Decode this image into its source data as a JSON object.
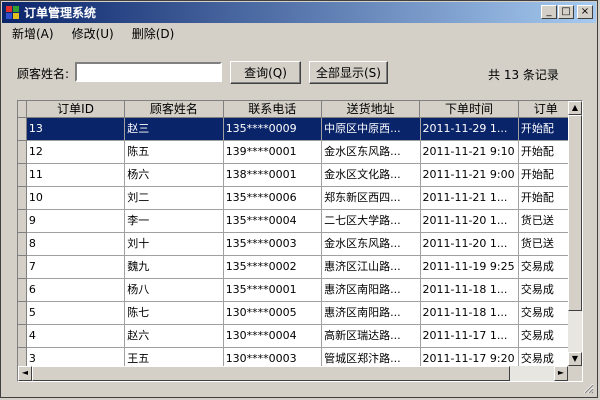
{
  "window": {
    "title": "订单管理系统",
    "controls": [
      "_",
      "□",
      "×"
    ],
    "colors": {
      "titlebar_start": "#0a246a",
      "titlebar_end": "#a6caf0",
      "selected_row": "#0a246a",
      "face": "#d4d0c8"
    }
  },
  "menu": [
    {
      "label": "新增(A)"
    },
    {
      "label": "修改(U)"
    },
    {
      "label": "删除(D)"
    }
  ],
  "search": {
    "label": "顾客姓名:",
    "value": "",
    "placeholder": "",
    "query_button": "查询(Q)",
    "show_all_button": "全部显示(S)"
  },
  "record_count": "共 13 条记录",
  "table": {
    "columns": [
      "订单ID",
      "顾客姓名",
      "联系电话",
      "送货地址",
      "下单时间",
      "订单"
    ],
    "rows": [
      [
        "13",
        "赵三",
        "135****0009",
        "中原区中原西...",
        "2011-11-29 1...",
        "开始配"
      ],
      [
        "12",
        "陈五",
        "139****0001",
        "金水区东风路...",
        "2011-11-21 9:10",
        "开始配"
      ],
      [
        "11",
        "杨六",
        "138****0001",
        "金水区文化路...",
        "2011-11-21 9:00",
        "开始配"
      ],
      [
        "10",
        "刘二",
        "135****0006",
        "郑东新区西四...",
        "2011-11-21 1...",
        "开始配"
      ],
      [
        "9",
        "李一",
        "135****0004",
        "二七区大学路...",
        "2011-11-20 1...",
        "货已送"
      ],
      [
        "8",
        "刘十",
        "135****0003",
        "金水区东风路...",
        "2011-11-20 1...",
        "货已送"
      ],
      [
        "7",
        "魏九",
        "135****0002",
        "惠济区江山路...",
        "2011-11-19 9:25",
        "交易成"
      ],
      [
        "6",
        "杨八",
        "135****0001",
        "惠济区南阳路...",
        "2011-11-18 1...",
        "交易成"
      ],
      [
        "5",
        "陈七",
        "130****0005",
        "惠济区南阳路...",
        "2011-11-18 1...",
        "交易成"
      ],
      [
        "4",
        "赵六",
        "130****0004",
        "高新区瑞达路...",
        "2011-11-17 1...",
        "交易成"
      ],
      [
        "3",
        "王五",
        "130****0003",
        "管城区郑汴路...",
        "2011-11-17 9:20",
        "交易成"
      ]
    ],
    "selected_index": 0,
    "scroll_arrows": {
      "up": "▲",
      "down": "▼",
      "left": "◄",
      "right": "►"
    }
  }
}
